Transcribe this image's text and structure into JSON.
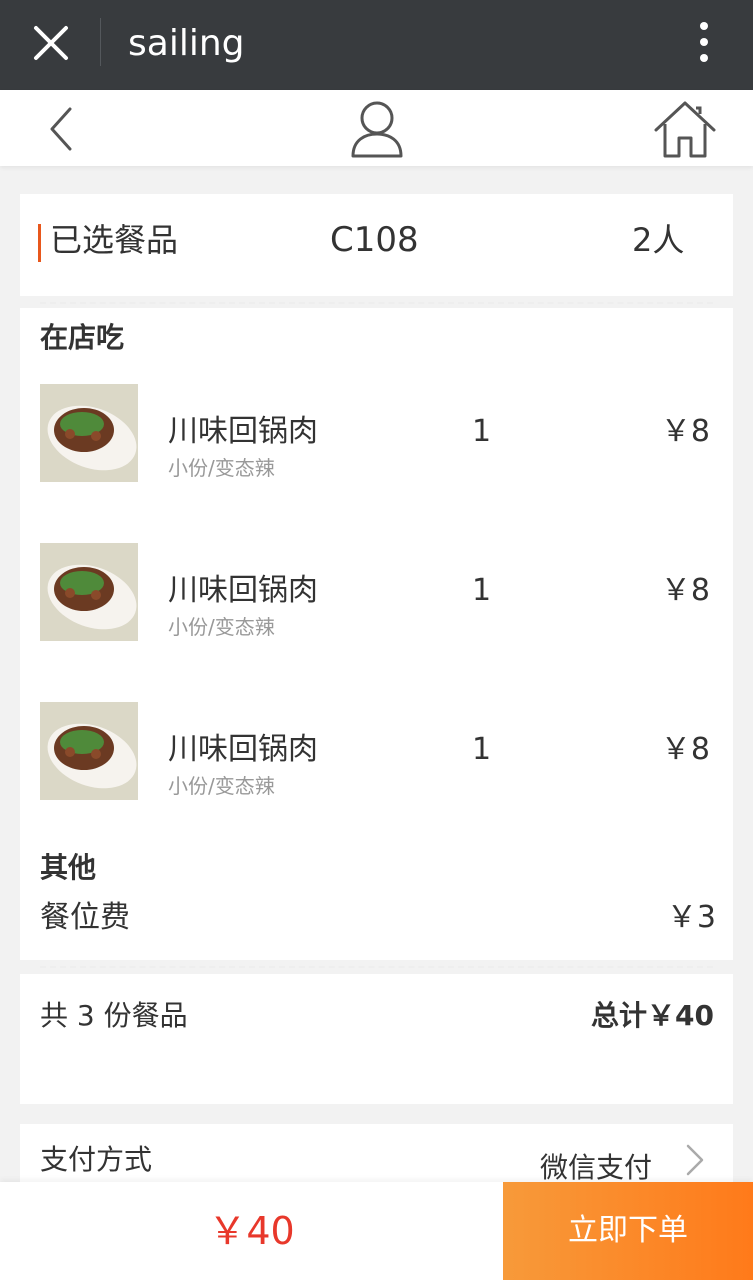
{
  "window": {
    "title": "sailing",
    "close_icon": "close-icon",
    "more_icon": "more-vertical-icon"
  },
  "navbar": {
    "back_icon": "chevron-left-icon",
    "user_icon": "user-icon",
    "home_icon": "home-icon"
  },
  "summary": {
    "label": "已选餐品",
    "table_no": "C108",
    "people": "2人"
  },
  "dine_in": {
    "title": "在店吃",
    "items": [
      {
        "name": "川味回锅肉",
        "spec": "小份/变态辣",
        "qty": "1",
        "price": "￥8"
      },
      {
        "name": "川味回锅肉",
        "spec": "小份/变态辣",
        "qty": "1",
        "price": "￥8"
      },
      {
        "name": "川味回锅肉",
        "spec": "小份/变态辣",
        "qty": "1",
        "price": "￥8"
      }
    ]
  },
  "other": {
    "title": "其他",
    "fee_label": "餐位费",
    "fee_price": "￥3"
  },
  "totals": {
    "count_text": "共 3 份餐品",
    "total_text": "总计￥40"
  },
  "payment": {
    "label": "支付方式",
    "method": "微信支付"
  },
  "footer": {
    "amount": "￥40",
    "order_label": "立即下单"
  },
  "colors": {
    "accent": "#e8571c",
    "price_red": "#e8382b",
    "order_orange": "#ff7a1a",
    "topbar": "#383b3e"
  }
}
